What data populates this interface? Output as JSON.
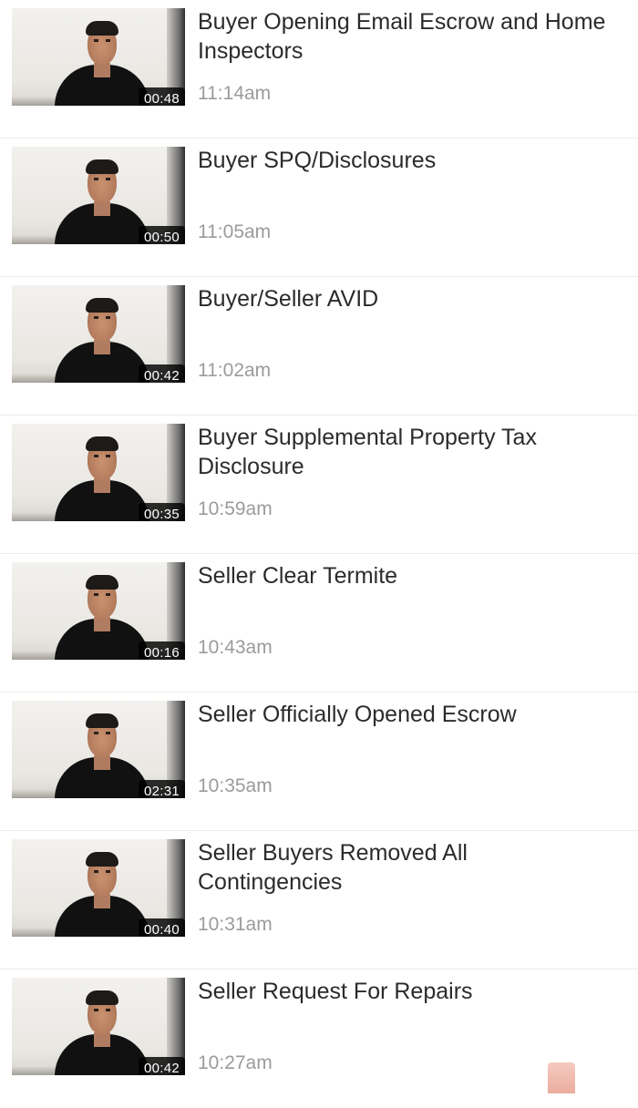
{
  "videos": [
    {
      "title": "Buyer Opening Email Escrow and Home Inspectors",
      "time": "11:14am",
      "duration": "00:48"
    },
    {
      "title": "Buyer SPQ/Disclosures",
      "time": "11:05am",
      "duration": "00:50"
    },
    {
      "title": "Buyer/Seller AVID",
      "time": "11:02am",
      "duration": "00:42"
    },
    {
      "title": "Buyer Supplemental Property Tax Disclosure",
      "time": "10:59am",
      "duration": "00:35"
    },
    {
      "title": "Seller Clear Termite",
      "time": "10:43am",
      "duration": "00:16"
    },
    {
      "title": "Seller Officially Opened Escrow",
      "time": "10:35am",
      "duration": "02:31"
    },
    {
      "title": "Seller Buyers Removed All Contingencies",
      "time": "10:31am",
      "duration": "00:40"
    },
    {
      "title": "Seller Request For Repairs",
      "time": "10:27am",
      "duration": "00:42"
    }
  ],
  "colors": {
    "title": "#2b2b2b",
    "timestamp": "#9b9b9b",
    "badge_bg": "#000000",
    "divider": "#ececec",
    "accent": "#e79f8c"
  }
}
